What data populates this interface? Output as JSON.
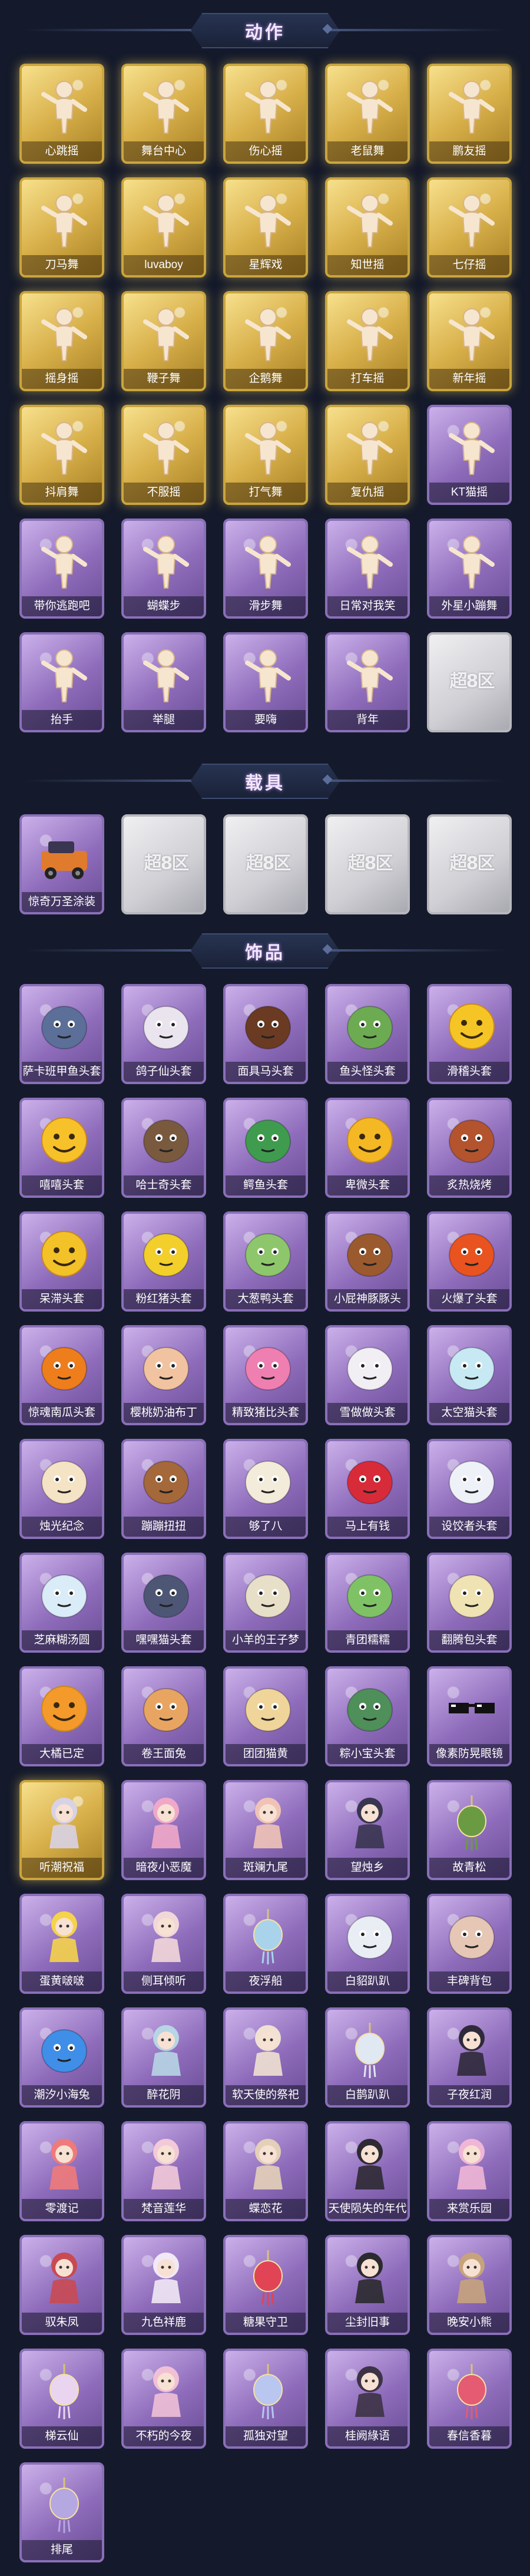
{
  "sections": {
    "actions": {
      "title": "动作"
    },
    "vehicles": {
      "title": "载具"
    },
    "accessories": {
      "title": "饰品"
    }
  },
  "placeholder_mark": "超8区",
  "colors": {
    "gold_tile": "#d8b04a",
    "purple_tile": "#8e6cbb",
    "gray_tile": "#cfcfd4",
    "background": "#141a2b"
  },
  "actions": [
    {
      "label": "心跳摇",
      "tier": "gold",
      "icon": "pose-figure"
    },
    {
      "label": "舞台中心",
      "tier": "gold",
      "icon": "pose-figure"
    },
    {
      "label": "伤心摇",
      "tier": "gold",
      "icon": "pose-figure"
    },
    {
      "label": "老鼠舞",
      "tier": "gold",
      "icon": "pose-figure"
    },
    {
      "label": "鹏友摇",
      "tier": "gold",
      "icon": "pose-figure"
    },
    {
      "label": "刀马舞",
      "tier": "gold",
      "icon": "pose-figure"
    },
    {
      "label": "luvaboy",
      "tier": "gold",
      "icon": "pose-figure"
    },
    {
      "label": "星辉戏",
      "tier": "gold",
      "icon": "pose-figure"
    },
    {
      "label": "知世摇",
      "tier": "gold",
      "icon": "pose-figure"
    },
    {
      "label": "七仔摇",
      "tier": "gold",
      "icon": "pose-figure"
    },
    {
      "label": "摇身摇",
      "tier": "gold",
      "icon": "pose-figure"
    },
    {
      "label": "鞭子舞",
      "tier": "gold",
      "icon": "pose-figure"
    },
    {
      "label": "企鹅舞",
      "tier": "gold",
      "icon": "pose-figure"
    },
    {
      "label": "打车摇",
      "tier": "gold",
      "icon": "pose-figure"
    },
    {
      "label": "新年摇",
      "tier": "gold",
      "icon": "pose-figure"
    },
    {
      "label": "抖肩舞",
      "tier": "gold",
      "icon": "pose-figure"
    },
    {
      "label": "不服摇",
      "tier": "gold",
      "icon": "pose-figure"
    },
    {
      "label": "打气舞",
      "tier": "gold",
      "icon": "pose-figure"
    },
    {
      "label": "复仇摇",
      "tier": "gold",
      "icon": "pose-figure"
    },
    {
      "label": "KT猫摇",
      "tier": "purple",
      "icon": "pose-figure"
    },
    {
      "label": "带你逃跑吧",
      "tier": "purple",
      "icon": "pose-figure"
    },
    {
      "label": "蝴蝶步",
      "tier": "purple",
      "icon": "pose-figure"
    },
    {
      "label": "滑步舞",
      "tier": "purple",
      "icon": "pose-figure"
    },
    {
      "label": "日常对我笑",
      "tier": "purple",
      "icon": "pose-figure"
    },
    {
      "label": "外星小蹦舞",
      "tier": "purple",
      "icon": "pose-figure"
    },
    {
      "label": "抬手",
      "tier": "purple",
      "icon": "pose-figure"
    },
    {
      "label": "举腿",
      "tier": "purple",
      "icon": "pose-figure"
    },
    {
      "label": "要嗨",
      "tier": "purple",
      "icon": "pose-figure"
    },
    {
      "label": "背年",
      "tier": "purple",
      "icon": "pose-figure"
    },
    {
      "label": "",
      "tier": "gray",
      "icon": "placeholder"
    }
  ],
  "vehicles": [
    {
      "label": "惊奇万圣涂装",
      "tier": "purple",
      "icon": "vehicle"
    },
    {
      "label": "",
      "tier": "gray",
      "icon": "placeholder"
    },
    {
      "label": "",
      "tier": "gray",
      "icon": "placeholder"
    },
    {
      "label": "",
      "tier": "gray",
      "icon": "placeholder"
    },
    {
      "label": "",
      "tier": "gray",
      "icon": "placeholder"
    }
  ],
  "accessories": [
    {
      "label": "萨卡班甲鱼头套",
      "tier": "purple",
      "icon": "fish-head",
      "color": "#5b6f99"
    },
    {
      "label": "鸽子仙头套",
      "tier": "purple",
      "icon": "bear-head",
      "color": "#e9e4ee"
    },
    {
      "label": "面具马头套",
      "tier": "purple",
      "icon": "horse-head",
      "color": "#6a3b22"
    },
    {
      "label": "鱼头怪头套",
      "tier": "purple",
      "icon": "fish-head",
      "color": "#6dab52"
    },
    {
      "label": "滑稽头套",
      "tier": "purple",
      "icon": "smiley-head",
      "color": "#f5c525"
    },
    {
      "label": "嘻嘻头套",
      "tier": "purple",
      "icon": "smiley-head",
      "color": "#f7c12a"
    },
    {
      "label": "哈士奇头套",
      "tier": "purple",
      "icon": "dog-head",
      "color": "#7a5a3f"
    },
    {
      "label": "鳄鱼头套",
      "tier": "purple",
      "icon": "croc-head",
      "color": "#3f9c4e"
    },
    {
      "label": "卑微头套",
      "tier": "purple",
      "icon": "smiley-head",
      "color": "#f3b824"
    },
    {
      "label": "炙热烧烤",
      "tier": "purple",
      "icon": "meat-head",
      "color": "#b3542e"
    },
    {
      "label": "呆滞头套",
      "tier": "purple",
      "icon": "smiley-head",
      "color": "#f2c228"
    },
    {
      "label": "粉红猪头套",
      "tier": "purple",
      "icon": "pika-head",
      "color": "#f2cf2b"
    },
    {
      "label": "大葱鸭头套",
      "tier": "purple",
      "icon": "leaf-head",
      "color": "#8ec76b"
    },
    {
      "label": "小屁神豚豚头",
      "tier": "purple",
      "icon": "poop-head",
      "color": "#9b5a2e"
    },
    {
      "label": "火爆了头套",
      "tier": "purple",
      "icon": "fire-head",
      "color": "#e9531f"
    },
    {
      "label": "惊魂南瓜头套",
      "tier": "purple",
      "icon": "pumpkin-head",
      "color": "#ee7d1c"
    },
    {
      "label": "樱桃奶油布丁",
      "tier": "purple",
      "icon": "pudding-head",
      "color": "#f2c3a0"
    },
    {
      "label": "精致猪比头套",
      "tier": "purple",
      "icon": "pig-head",
      "color": "#ef7fb0"
    },
    {
      "label": "雪做做头套",
      "tier": "purple",
      "icon": "snow-head",
      "color": "#f1eef4"
    },
    {
      "label": "太空猫头套",
      "tier": "purple",
      "icon": "ghost-head",
      "color": "#c7e9f4"
    },
    {
      "label": "烛光纪念",
      "tier": "purple",
      "icon": "candle-head",
      "color": "#f5e3c5"
    },
    {
      "label": "蹦蹦扭扭",
      "tier": "purple",
      "icon": "dog-head",
      "color": "#a4683a"
    },
    {
      "label": "够了八",
      "tier": "purple",
      "icon": "radish-head",
      "color": "#f3ecda"
    },
    {
      "label": "马上有钱",
      "tier": "purple",
      "icon": "parrot-head",
      "color": "#d82b3a"
    },
    {
      "label": "设饺者头套",
      "tier": "purple",
      "icon": "cloud-head",
      "color": "#eef2f8"
    },
    {
      "label": "芝麻糊汤圆",
      "tier": "purple",
      "icon": "ball-head",
      "color": "#d9ecf7"
    },
    {
      "label": "嘿嘿猫头套",
      "tier": "purple",
      "icon": "cat-head",
      "color": "#4d5775"
    },
    {
      "label": "小羊的王子梦",
      "tier": "purple",
      "icon": "sheep-head",
      "color": "#e8dfc8"
    },
    {
      "label": "青团糯糯",
      "tier": "purple",
      "icon": "ball-head",
      "color": "#7fc266"
    },
    {
      "label": "翻腾包头套",
      "tier": "purple",
      "icon": "bun-head",
      "color": "#efe3b4"
    },
    {
      "label": "大橘已定",
      "tier": "purple",
      "icon": "orange-head",
      "color": "#f39a2a"
    },
    {
      "label": "卷王面兔",
      "tier": "purple",
      "icon": "roll-head",
      "color": "#e8a562"
    },
    {
      "label": "团团猫黄",
      "tier": "purple",
      "icon": "cat-head",
      "color": "#f0d59a"
    },
    {
      "label": "粽小宝头套",
      "tier": "purple",
      "icon": "zongzi-head",
      "color": "#4f8f5a"
    },
    {
      "label": "像素防晃眼镜",
      "tier": "purple",
      "icon": "glasses",
      "color": "#111111"
    },
    {
      "label": "听潮祝福",
      "tier": "gold",
      "icon": "girl-figure",
      "color": "#d8d2e6"
    },
    {
      "label": "暗夜小恶魔",
      "tier": "purple",
      "icon": "fox-figure",
      "color": "#f0a8c8"
    },
    {
      "label": "斑斓九尾",
      "tier": "purple",
      "icon": "fox-figure",
      "color": "#f0c3b6"
    },
    {
      "label": "望烛乡",
      "tier": "purple",
      "icon": "girl-figure",
      "color": "#3a3550"
    },
    {
      "label": "故青松",
      "tier": "purple",
      "icon": "bonsai",
      "color": "#6a9b43"
    },
    {
      "label": "蛋黄啵啵",
      "tier": "purple",
      "icon": "chick-figure",
      "color": "#f5d34a"
    },
    {
      "label": "侧耳倾听",
      "tier": "purple",
      "icon": "rabbit-figure",
      "color": "#f2d7d9"
    },
    {
      "label": "夜浮船",
      "tier": "purple",
      "icon": "ornament",
      "color": "#a9d3ea"
    },
    {
      "label": "白貂趴趴",
      "tier": "purple",
      "icon": "ghost-head",
      "color": "#e9eef5"
    },
    {
      "label": "丰碑背包",
      "tier": "purple",
      "icon": "bear-head",
      "color": "#e6c7b6"
    },
    {
      "label": "潮汐小海兔",
      "tier": "purple",
      "icon": "cat-head",
      "color": "#3f8fe8"
    },
    {
      "label": "醉花阴",
      "tier": "purple",
      "icon": "girl-figure",
      "color": "#b7d5e4"
    },
    {
      "label": "软天使的祭祀",
      "tier": "purple",
      "icon": "girl-figure",
      "color": "#f0e1d2"
    },
    {
      "label": "白鹊趴趴",
      "tier": "purple",
      "icon": "bottle",
      "color": "#e0e8f2"
    },
    {
      "label": "子夜红润",
      "tier": "purple",
      "icon": "girl-figure",
      "color": "#2f2a3a"
    },
    {
      "label": "零渡记",
      "tier": "purple",
      "icon": "bird-figure",
      "color": "#ef7a7a"
    },
    {
      "label": "梵音莲华",
      "tier": "purple",
      "icon": "girl-figure",
      "color": "#f2c9d8"
    },
    {
      "label": "蝶恋花",
      "tier": "purple",
      "icon": "girl-figure",
      "color": "#e4d0b8"
    },
    {
      "label": "天使陨失的年代",
      "tier": "purple",
      "icon": "girl-figure",
      "color": "#2e2a33"
    },
    {
      "label": "来赏乐园",
      "tier": "purple",
      "icon": "girl-figure",
      "color": "#f0b6d6"
    },
    {
      "label": "驭朱凤",
      "tier": "purple",
      "icon": "girl-figure",
      "color": "#c94a52"
    },
    {
      "label": "九色祥鹿",
      "tier": "purple",
      "icon": "deer-figure",
      "color": "#f1e9f5"
    },
    {
      "label": "糖果守卫",
      "tier": "purple",
      "icon": "lantern",
      "color": "#e14454"
    },
    {
      "label": "尘封旧事",
      "tier": "purple",
      "icon": "boy-figure",
      "color": "#2a2a2f"
    },
    {
      "label": "晚安小熊",
      "tier": "purple",
      "icon": "bear-figure",
      "color": "#c6a37c"
    },
    {
      "label": "梯云仙",
      "tier": "purple",
      "icon": "ornament",
      "color": "#e9d5ef"
    },
    {
      "label": "不朽的今夜",
      "tier": "purple",
      "icon": "fox-figure",
      "color": "#f0c0d6"
    },
    {
      "label": "孤独对望",
      "tier": "purple",
      "icon": "ornament",
      "color": "#b8c6f0"
    },
    {
      "label": "桂阙綠语",
      "tier": "purple",
      "icon": "girl-figure",
      "color": "#3d3346"
    },
    {
      "label": "春信香暮",
      "tier": "purple",
      "icon": "ornament",
      "color": "#e45b72"
    },
    {
      "label": "排尾",
      "tier": "purple",
      "icon": "tassel",
      "color": "#b5a7e0"
    }
  ]
}
